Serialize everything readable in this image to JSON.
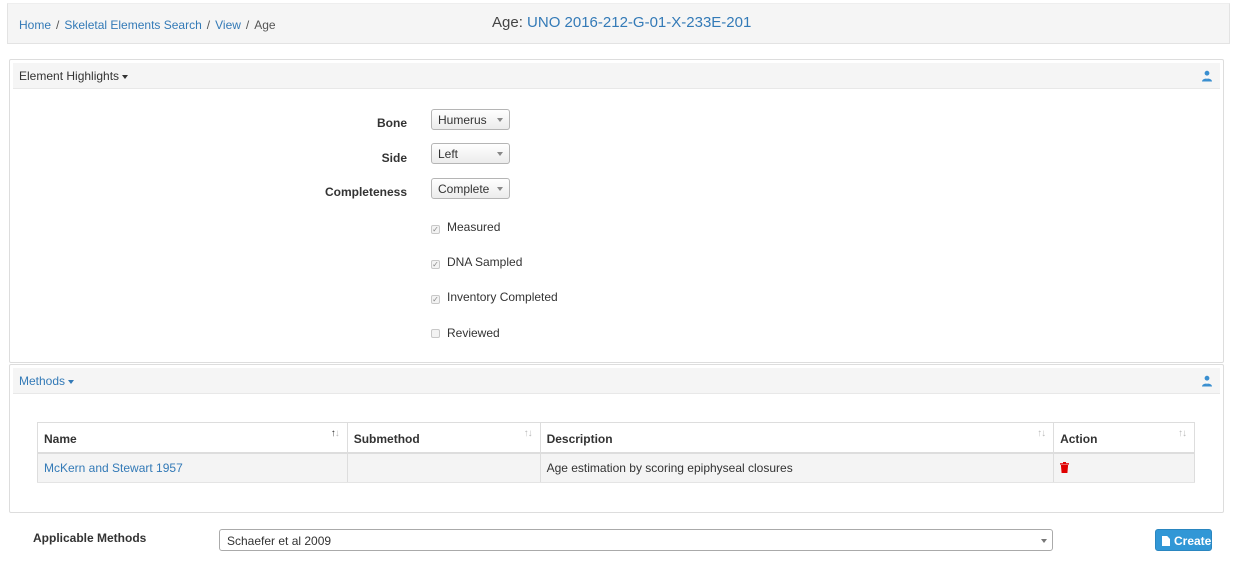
{
  "breadcrumb": {
    "items": [
      "Home",
      "Skeletal Elements Search",
      "View"
    ],
    "current": "Age",
    "separator": "/"
  },
  "title": {
    "label": "Age:",
    "value": "UNO 2016-212-G-01-X-233E-201"
  },
  "element_highlights": {
    "heading": "Element Highlights",
    "icon": "user-icon",
    "fields": {
      "bone": {
        "label": "Bone",
        "value": "Humerus"
      },
      "side": {
        "label": "Side",
        "value": "Left"
      },
      "completeness": {
        "label": "Completeness",
        "value": "Complete"
      }
    },
    "checkboxes": [
      {
        "label": "Measured",
        "checked": true
      },
      {
        "label": "DNA Sampled",
        "checked": true
      },
      {
        "label": "Inventory Completed",
        "checked": true
      },
      {
        "label": "Reviewed",
        "checked": false
      }
    ]
  },
  "methods": {
    "heading": "Methods",
    "icon": "user-icon",
    "columns": [
      "Name",
      "Submethod",
      "Description",
      "Action"
    ],
    "rows": [
      {
        "name": "McKern and Stewart 1957",
        "submethod": "",
        "description": "Age estimation by scoring epiphyseal closures",
        "action_icon": "trash-icon"
      }
    ]
  },
  "applicable_methods": {
    "label": "Applicable Methods",
    "selected": "Schaefer et al 2009",
    "button_label": "Create",
    "button_icon": "file-icon"
  },
  "colors": {
    "link": "#337ab7",
    "create_button": "#3197d6",
    "delete": "#e00000"
  }
}
